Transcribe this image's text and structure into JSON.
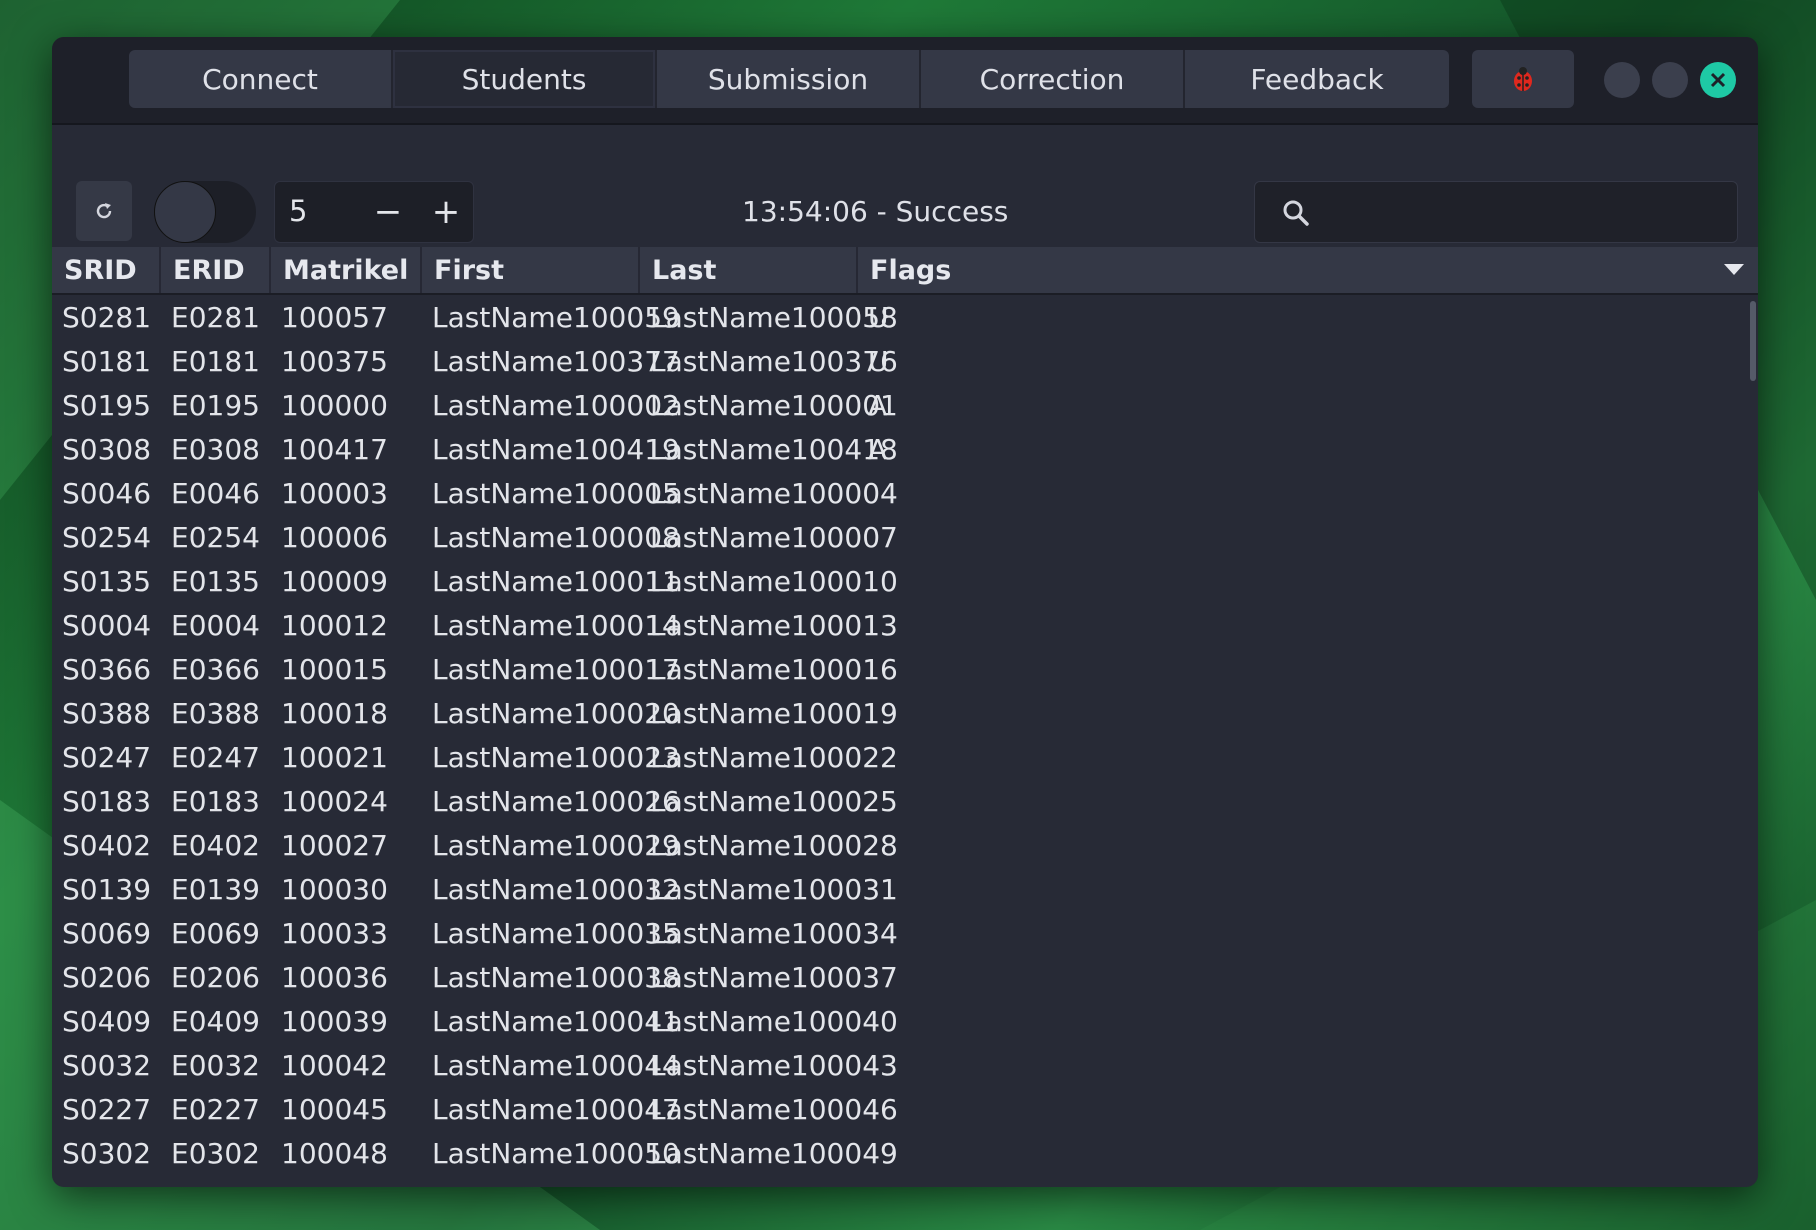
{
  "tabs": [
    {
      "label": "Connect"
    },
    {
      "label": "Students"
    },
    {
      "label": "Submission"
    },
    {
      "label": "Correction"
    },
    {
      "label": "Feedback"
    }
  ],
  "toolbar": {
    "spin_value": "5",
    "minus": "−",
    "plus": "+",
    "status": "13:54:06 - Success",
    "search_value": ""
  },
  "table": {
    "columns": [
      "SRID",
      "ERID",
      "Matrikel",
      "First",
      "Last",
      "Flags"
    ],
    "rows": [
      [
        "S0281",
        "E0281",
        "100057",
        "LastName100059",
        "LastName100058",
        "U"
      ],
      [
        "S0181",
        "E0181",
        "100375",
        "LastName100377",
        "LastName100376",
        "U"
      ],
      [
        "S0195",
        "E0195",
        "100000",
        "LastName100002",
        "LastName100001",
        "A"
      ],
      [
        "S0308",
        "E0308",
        "100417",
        "LastName100419",
        "LastName100418",
        "A"
      ],
      [
        "S0046",
        "E0046",
        "100003",
        "LastName100005",
        "LastName100004",
        ""
      ],
      [
        "S0254",
        "E0254",
        "100006",
        "LastName100008",
        "LastName100007",
        ""
      ],
      [
        "S0135",
        "E0135",
        "100009",
        "LastName100011",
        "LastName100010",
        ""
      ],
      [
        "S0004",
        "E0004",
        "100012",
        "LastName100014",
        "LastName100013",
        ""
      ],
      [
        "S0366",
        "E0366",
        "100015",
        "LastName100017",
        "LastName100016",
        ""
      ],
      [
        "S0388",
        "E0388",
        "100018",
        "LastName100020",
        "LastName100019",
        ""
      ],
      [
        "S0247",
        "E0247",
        "100021",
        "LastName100023",
        "LastName100022",
        ""
      ],
      [
        "S0183",
        "E0183",
        "100024",
        "LastName100026",
        "LastName100025",
        ""
      ],
      [
        "S0402",
        "E0402",
        "100027",
        "LastName100029",
        "LastName100028",
        ""
      ],
      [
        "S0139",
        "E0139",
        "100030",
        "LastName100032",
        "LastName100031",
        ""
      ],
      [
        "S0069",
        "E0069",
        "100033",
        "LastName100035",
        "LastName100034",
        ""
      ],
      [
        "S0206",
        "E0206",
        "100036",
        "LastName100038",
        "LastName100037",
        ""
      ],
      [
        "S0409",
        "E0409",
        "100039",
        "LastName100041",
        "LastName100040",
        ""
      ],
      [
        "S0032",
        "E0032",
        "100042",
        "LastName100044",
        "LastName100043",
        ""
      ],
      [
        "S0227",
        "E0227",
        "100045",
        "LastName100047",
        "LastName100046",
        ""
      ],
      [
        "S0302",
        "E0302",
        "100048",
        "LastName100050",
        "LastName100049",
        ""
      ]
    ]
  },
  "colors": {
    "accent_close": "#1ec9a5",
    "window_bg": "#272a36",
    "header_bg": "#1e2029"
  },
  "icons": [
    "bug-icon",
    "refresh-icon",
    "search-icon",
    "close-icon",
    "chevron-down-icon"
  ]
}
